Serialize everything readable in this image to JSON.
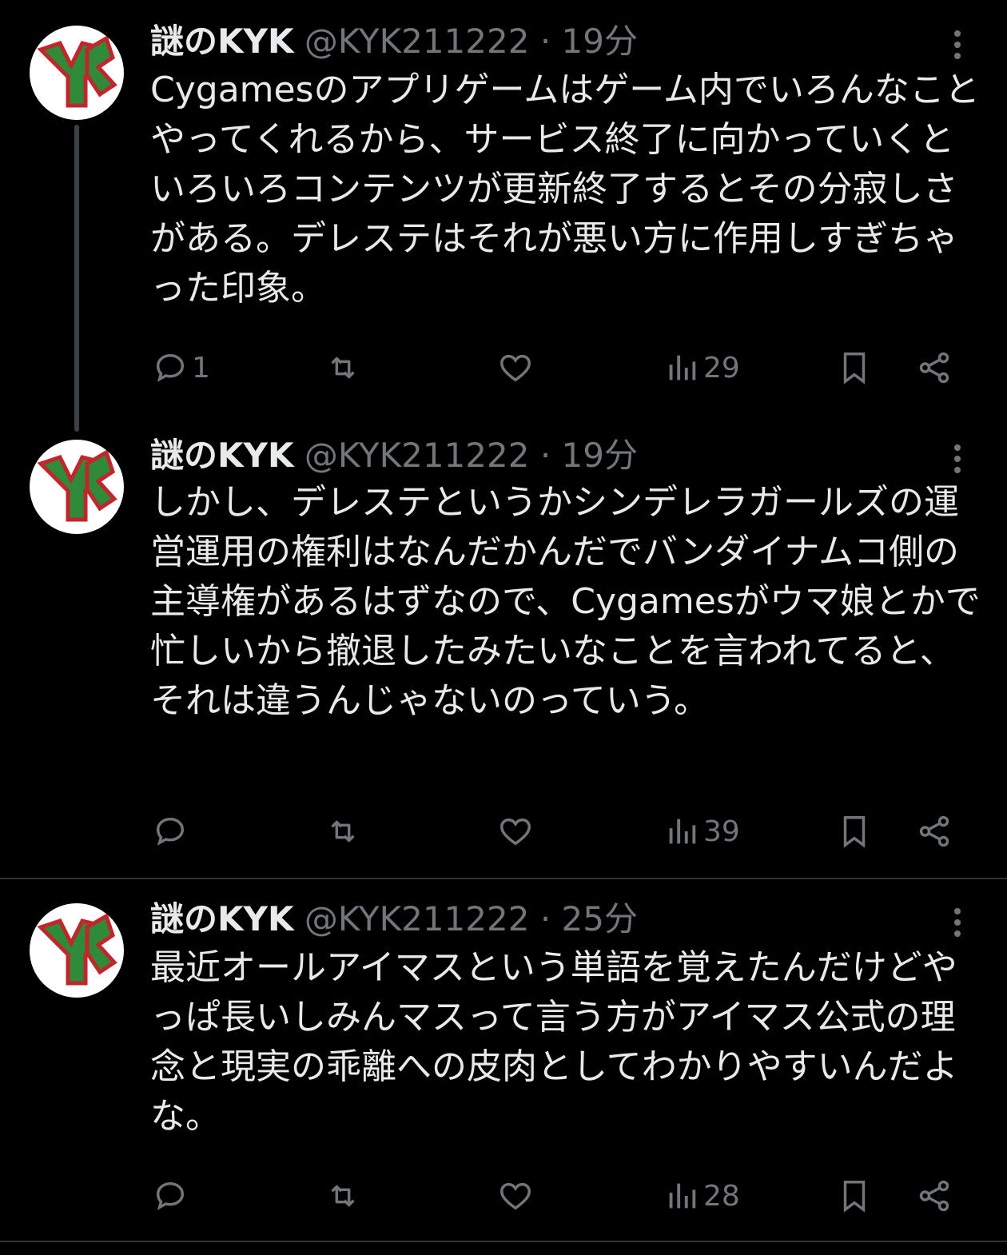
{
  "colors": {
    "background": "#000000",
    "text": "#e7e9ea",
    "muted": "#71767b",
    "avatar_red": "#c0262b",
    "avatar_green": "#2f8a3a"
  },
  "tweets": [
    {
      "name": "謎のKYK",
      "handle": "@KYK211222",
      "dot": "·",
      "time": "19分",
      "text": "Cygamesのアプリゲームはゲーム内でいろんなことやってくれるから、サービス終了に向かっていくといろいろコンテンツが更新終了するとその分寂しさがある。デレステはそれが悪い方に作用しすぎちゃった印象。",
      "replies": "1",
      "views": "29"
    },
    {
      "name": "謎のKYK",
      "handle": "@KYK211222",
      "dot": "·",
      "time": "19分",
      "text": "しかし、デレステというかシンデレラガールズの運営運用の権利はなんだかんだでバンダイナムコ側の主導権があるはずなので、Cygamesがウマ娘とかで忙しいから撤退したみたいなことを言われてると、それは違うんじゃないのっていう。",
      "replies": "",
      "views": "39"
    },
    {
      "name": "謎のKYK",
      "handle": "@KYK211222",
      "dot": "·",
      "time": "25分",
      "text": "最近オールアイマスという単語を覚えたんだけどやっぱ長いしみんマスって言う方がアイマス公式の理念と現実の乖離への皮肉としてわかりやすいんだよな。",
      "replies": "",
      "views": "28"
    }
  ],
  "icons": [
    "reply-icon",
    "retweet-icon",
    "like-icon",
    "views-icon",
    "bookmark-icon",
    "share-icon",
    "more-icon"
  ]
}
